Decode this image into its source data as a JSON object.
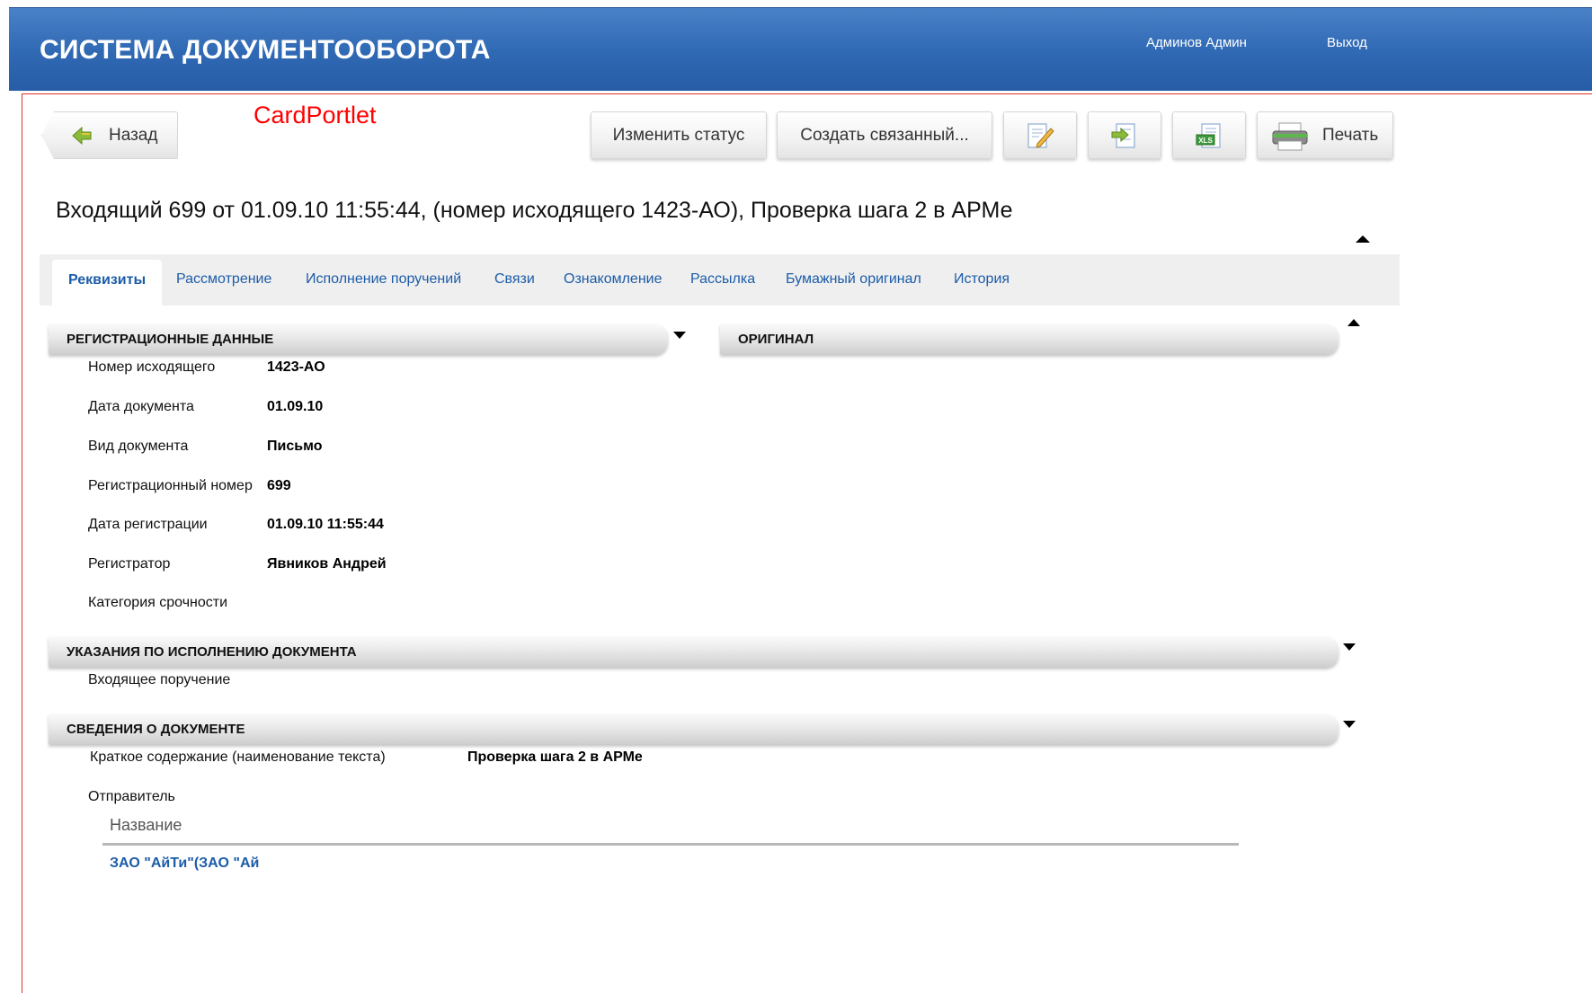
{
  "header": {
    "app_title": "СИСТЕМА ДОКУМЕНТООБОРОТА",
    "user_name": "Админов Админ",
    "logout_label": "Выход"
  },
  "portlet": {
    "label": "CardPortlet"
  },
  "toolbar": {
    "back_label": "Назад",
    "change_status_label": "Изменить статус",
    "create_related_label": "Создать связанный...",
    "edit_icon": "edit-document-icon",
    "export_icon": "export-document-icon",
    "xls_icon": "xls-export-icon",
    "print_label": "Печать"
  },
  "document": {
    "title": "Входящий 699 от 01.09.10 11:55:44, (номер исходящего 1423-АО), Проверка шага 2 в АРМе"
  },
  "tabs": [
    {
      "label": "Реквизиты",
      "active": true
    },
    {
      "label": "Рассмотрение",
      "active": false
    },
    {
      "label": "Исполнение поручений",
      "active": false
    },
    {
      "label": "Связи",
      "active": false
    },
    {
      "label": "Ознакомление",
      "active": false
    },
    {
      "label": "Рассылка",
      "active": false
    },
    {
      "label": "Бумажный оригинал",
      "active": false
    },
    {
      "label": "История",
      "active": false
    }
  ],
  "sections": {
    "registration": {
      "title": "РЕГИСТРАЦИОННЫЕ ДАННЫЕ",
      "fields": [
        {
          "label": "Номер исходящего",
          "value": "1423-АО"
        },
        {
          "label": "Дата документа",
          "value": "01.09.10"
        },
        {
          "label": "Вид документа",
          "value": "Письмо"
        },
        {
          "label": "Регистрационный номер",
          "value": "699"
        },
        {
          "label": "Дата регистрации",
          "value": "01.09.10 11:55:44"
        },
        {
          "label": "Регистратор",
          "value": "Явников Андрей"
        },
        {
          "label": "Категория срочности",
          "value": ""
        }
      ]
    },
    "original": {
      "title": "ОРИГИНАЛ"
    },
    "instructions": {
      "title": "УКАЗАНИЯ ПО ИСПОЛНЕНИЮ ДОКУМЕНТА",
      "item": "Входящее поручение"
    },
    "doc_info": {
      "title": "СВЕДЕНИЯ О ДОКУМЕНТЕ",
      "summary_label": "Краткое содержание (наименование текста)",
      "summary_value": "Проверка шага 2 в АРМе",
      "sender_label": "Отправитель",
      "sender_table": {
        "column_header": "Название",
        "rows": [
          "ЗАО \"АйТи\"(ЗАО \"Ай"
        ]
      }
    }
  },
  "colors": {
    "header_blue": "#2f68b3",
    "link_blue": "#1c5ca8",
    "portlet_label_red": "#ff0000"
  }
}
